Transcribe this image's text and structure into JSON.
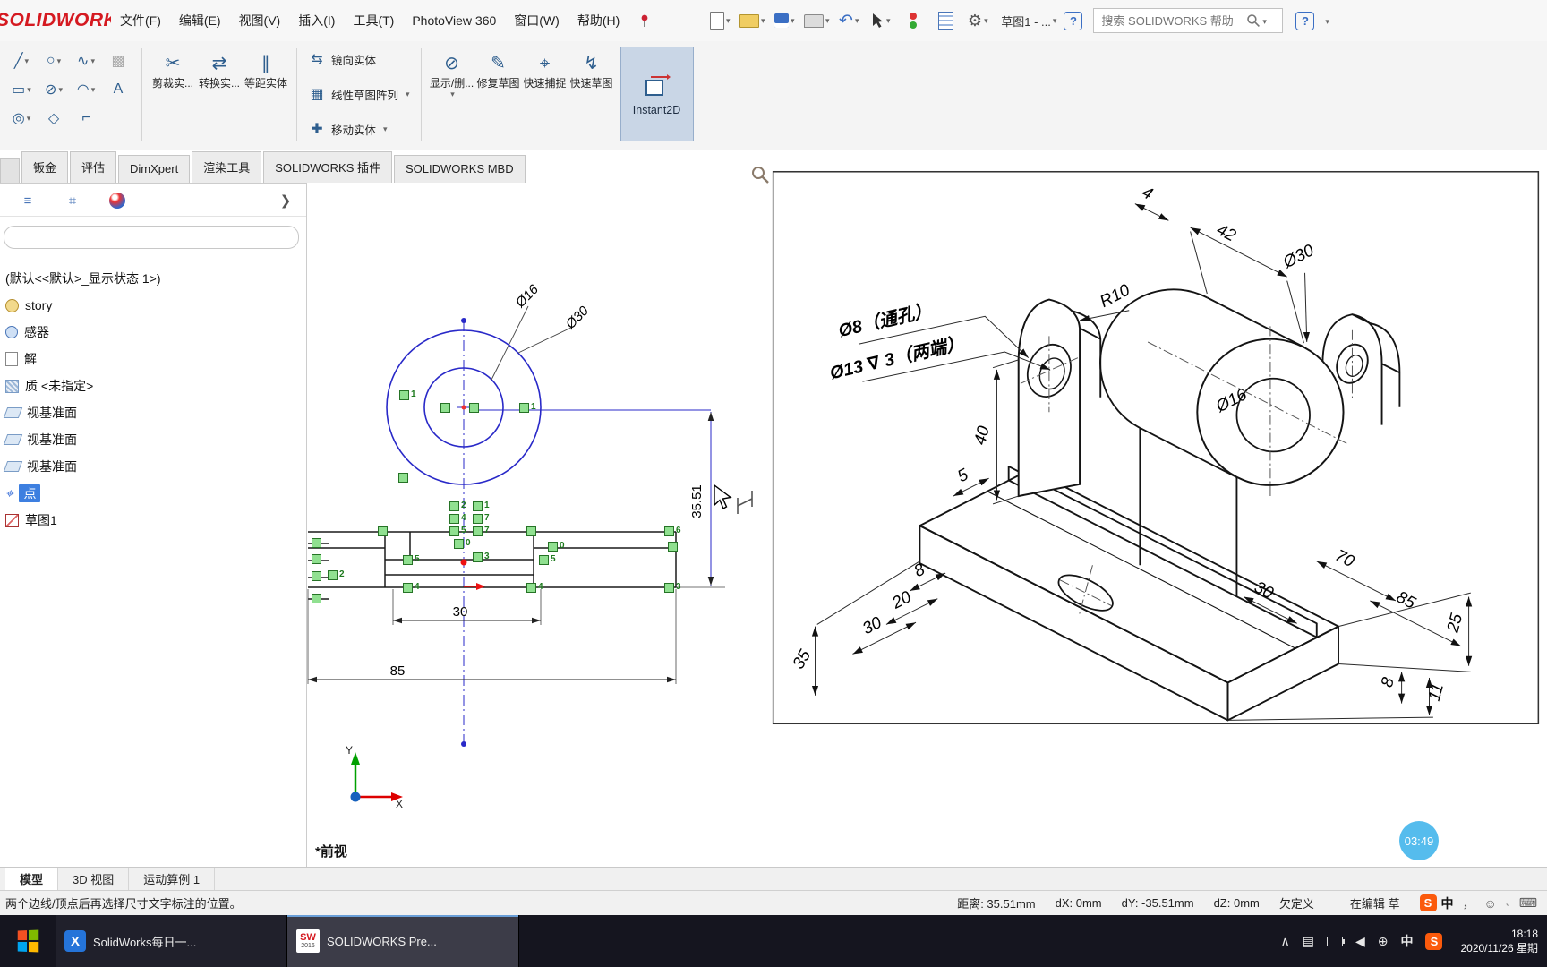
{
  "menubar": {
    "logo": "SOLIDWORKS",
    "menus": [
      "文件(F)",
      "编辑(E)",
      "视图(V)",
      "插入(I)",
      "工具(T)",
      "PhotoView 360",
      "窗口(W)",
      "帮助(H)"
    ],
    "doc_switcher": "草图1 - ...",
    "help": "?",
    "search_placeholder": "搜索 SOLIDWORKS 帮助"
  },
  "icons": {
    "line": "╱",
    "rectangle": "▭",
    "slot": "◎",
    "circle": "○",
    "ellipse": "⊘",
    "polygon": "◇",
    "spline": "∿",
    "arc": "◠",
    "text_tool": "A",
    "grid_extra": "▩",
    "trim": "✂",
    "convert": "⇄",
    "offset": "∥",
    "mirror": "⇆",
    "pattern": "▦",
    "move": "✚",
    "display_delete": "⊘",
    "repair": "✎",
    "quick_snap": "⌖",
    "quick_sketch": "↯",
    "undo": "↶",
    "gear": "⚙",
    "tray_expand": "∧",
    "tray_grid": "▤",
    "network": "⊕",
    "volume": "◀",
    "panel_tab1": "≡",
    "panel_tab2": "⌗",
    "chevron": "❯"
  },
  "toolbar": {
    "trim": "剪裁实...",
    "convert": "转换实...",
    "offset": "等距实体",
    "mirror": "镜向实体",
    "pattern": "线性草图阵列",
    "move": "移动实体",
    "display_delete": "显示/删...",
    "repair": "修复草图",
    "quick_snap": "快速捕捉",
    "quick_sketch": "快速草图",
    "instant2d": "Instant2D"
  },
  "tabstrip": [
    "钣金",
    "评估",
    "DimXpert",
    "渲染工具",
    "SOLIDWORKS 插件",
    "SOLIDWORKS MBD"
  ],
  "feature_tree": {
    "items": [
      "(默认<<默认>_显示状态 1>)",
      "story",
      "感器",
      "解",
      "质 <未指定>",
      "视基准面",
      "视基准面",
      "视基准面",
      "点",
      "草图1"
    ]
  },
  "sketch": {
    "dim_d16": "Ø16",
    "dim_d30": "Ø30",
    "dim_height": "35.51",
    "dim_w30": "30",
    "dim_w85": "85",
    "markers": [
      "1",
      "2",
      "5",
      "4",
      "2",
      "1",
      "4",
      "7",
      "5",
      "7",
      "0",
      "3",
      "5",
      "4",
      "0",
      "6",
      "3",
      "1"
    ],
    "view_label": "*前视",
    "axis_x": "X",
    "axis_y": "Y"
  },
  "drawing": {
    "dims": {
      "top4": "4",
      "top42": "42",
      "r10": "R10",
      "d30": "Ø30",
      "note1": "Ø8（通孔）",
      "note2": "Ø13 ∇ 3（两端）",
      "d16": "Ø16",
      "h40": "40",
      "s5": "5",
      "s8": "8",
      "s20": "20",
      "s30": "30",
      "s35": "35",
      "r30": "30",
      "r70": "70",
      "r85": "85",
      "v25": "25",
      "v8": "8",
      "v11": "11"
    }
  },
  "overlay": {
    "badge": "03:49"
  },
  "doc_tabs": [
    "模型",
    "3D 视图",
    "运动算例 1"
  ],
  "statusbar": {
    "hint": "两个边线/顶点后再选择尺寸文字标注的位置。",
    "distance": "距离: 35.51mm",
    "dx": "dX: 0mm",
    "dy": "dY: -35.51mm",
    "dz": "dZ: 0mm",
    "state": "欠定义",
    "editing": "在编辑 草",
    "ime": "中",
    "sogou": "S"
  },
  "taskbar": {
    "apps": [
      "SolidWorks每日一...",
      "SOLIDWORKS Pre..."
    ],
    "app1_glyph": "X",
    "app2_brand": "SW",
    "app2_year": "2016",
    "ime": "中",
    "sogou": "S",
    "time": "18:18",
    "date": "2020/11/26 星期"
  }
}
